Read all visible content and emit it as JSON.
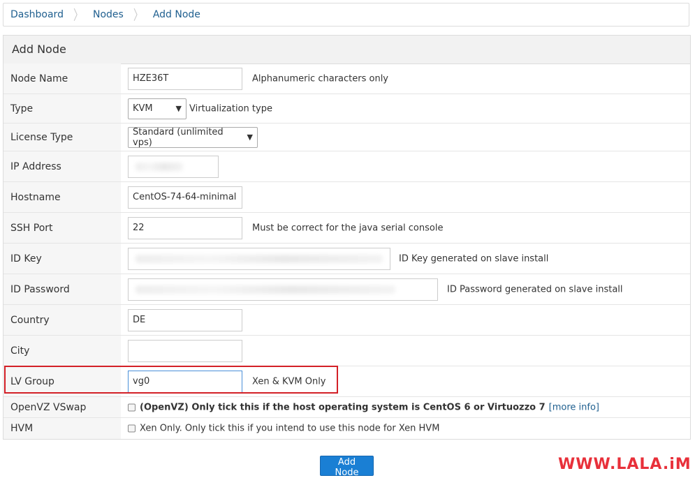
{
  "breadcrumb": {
    "items": [
      "Dashboard",
      "Nodes",
      "Add Node"
    ]
  },
  "panel": {
    "title": "Add Node"
  },
  "form": {
    "node_name": {
      "label": "Node Name",
      "value": "HZE36T",
      "help": "Alphanumeric characters only"
    },
    "type": {
      "label": "Type",
      "value": "KVM",
      "help": "Virtualization type"
    },
    "license_type": {
      "label": "License Type",
      "value": "Standard (unlimited vps)"
    },
    "ip_address": {
      "label": "IP Address"
    },
    "hostname": {
      "label": "Hostname",
      "value": "CentOS-74-64-minimal"
    },
    "ssh_port": {
      "label": "SSH Port",
      "value": "22",
      "help": "Must be correct for the java serial console"
    },
    "id_key": {
      "label": "ID Key",
      "help": "ID Key generated on slave install"
    },
    "id_password": {
      "label": "ID Password",
      "help": "ID Password generated on slave install"
    },
    "country": {
      "label": "Country",
      "value": "DE"
    },
    "city": {
      "label": "City",
      "value": ""
    },
    "lv_group": {
      "label": "LV Group",
      "value": "vg0",
      "help": "Xen & KVM Only"
    },
    "openvz_vswap": {
      "label": "OpenVZ VSwap",
      "text": "(OpenVZ) Only tick this if the host operating system is CentOS 6 or Virtuozzo 7",
      "link": "[more info]"
    },
    "hvm": {
      "label": "HVM",
      "text": "Xen Only. Only tick this if you intend to use this node for Xen HVM"
    }
  },
  "submit_label": "Add Node",
  "watermark": "WWW.LALA.iM",
  "colors": {
    "link": "#1f5f8f",
    "button": "#1a7fd4",
    "highlight": "#d32027"
  }
}
